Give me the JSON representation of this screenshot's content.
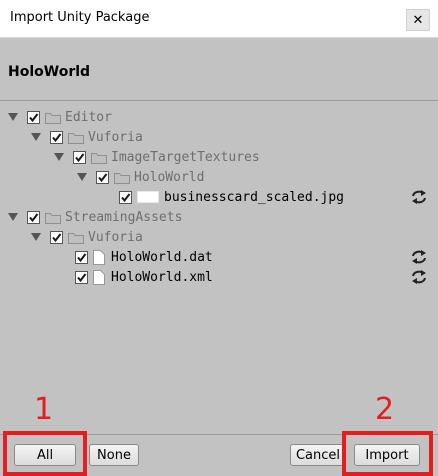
{
  "window": {
    "title": "Import Unity Package",
    "close_glyph": "✕"
  },
  "header": {
    "package_name": "HoloWorld"
  },
  "tree": {
    "items": [
      {
        "label": "Editor",
        "kind": "folder",
        "checked": true,
        "expanded": true,
        "status": "existing"
      },
      {
        "label": "Vuforia",
        "kind": "folder",
        "checked": true,
        "expanded": true,
        "status": "existing"
      },
      {
        "label": "ImageTargetTextures",
        "kind": "folder",
        "checked": true,
        "expanded": true,
        "status": "existing"
      },
      {
        "label": "HoloWorld",
        "kind": "folder",
        "checked": true,
        "expanded": true,
        "status": "existing"
      },
      {
        "label": "businesscard_scaled.jpg",
        "kind": "image",
        "checked": true,
        "status": "changed"
      },
      {
        "label": "StreamingAssets",
        "kind": "folder",
        "checked": true,
        "expanded": true,
        "status": "existing"
      },
      {
        "label": "Vuforia",
        "kind": "folder",
        "checked": true,
        "expanded": true,
        "status": "existing"
      },
      {
        "label": "HoloWorld.dat",
        "kind": "file",
        "checked": true,
        "status": "changed"
      },
      {
        "label": "HoloWorld.xml",
        "kind": "file",
        "checked": true,
        "status": "changed"
      }
    ]
  },
  "footer": {
    "all_label": "All",
    "none_label": "None",
    "cancel_label": "Cancel",
    "import_label": "Import"
  },
  "annotations": {
    "marker_1": "1",
    "marker_2": "2",
    "color": "#e41e1e"
  },
  "colors": {
    "panel": "#c2c2c2",
    "dim_text": "#6e6e6e"
  }
}
